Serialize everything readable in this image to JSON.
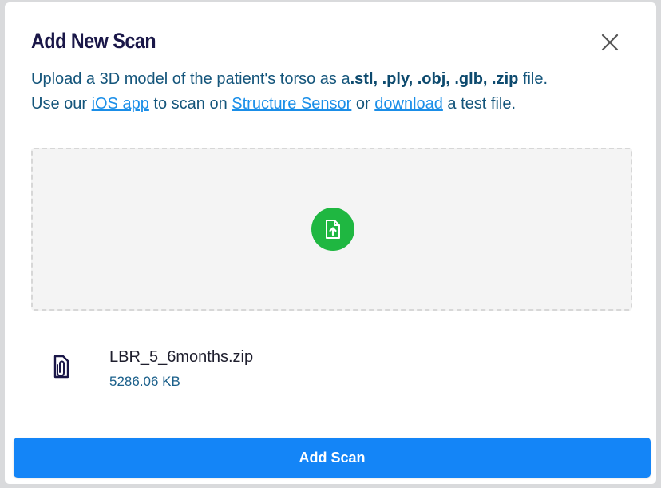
{
  "dialog": {
    "title": "Add New Scan",
    "close_icon": "close-icon"
  },
  "description": {
    "line1_prefix": "Upload a 3D model of the patient's torso as a",
    "formats": ".stl, .ply, .obj, .glb, .zip",
    "line1_suffix": " file.",
    "line2_prefix": "Use our ",
    "ios_link": "iOS app",
    "line2_mid1": " to scan on ",
    "sensor_link": "Structure Sensor",
    "line2_mid2": " or ",
    "download_link": "download",
    "line2_suffix": " a test file."
  },
  "dropzone": {
    "icon": "file-upload-icon",
    "icon_color": "#1fb741"
  },
  "file": {
    "icon": "paperclip-file-icon",
    "name": "LBR_5_6months.zip",
    "size": "5286.06 KB"
  },
  "actions": {
    "add_scan_label": "Add Scan",
    "button_color": "#1485f7"
  }
}
